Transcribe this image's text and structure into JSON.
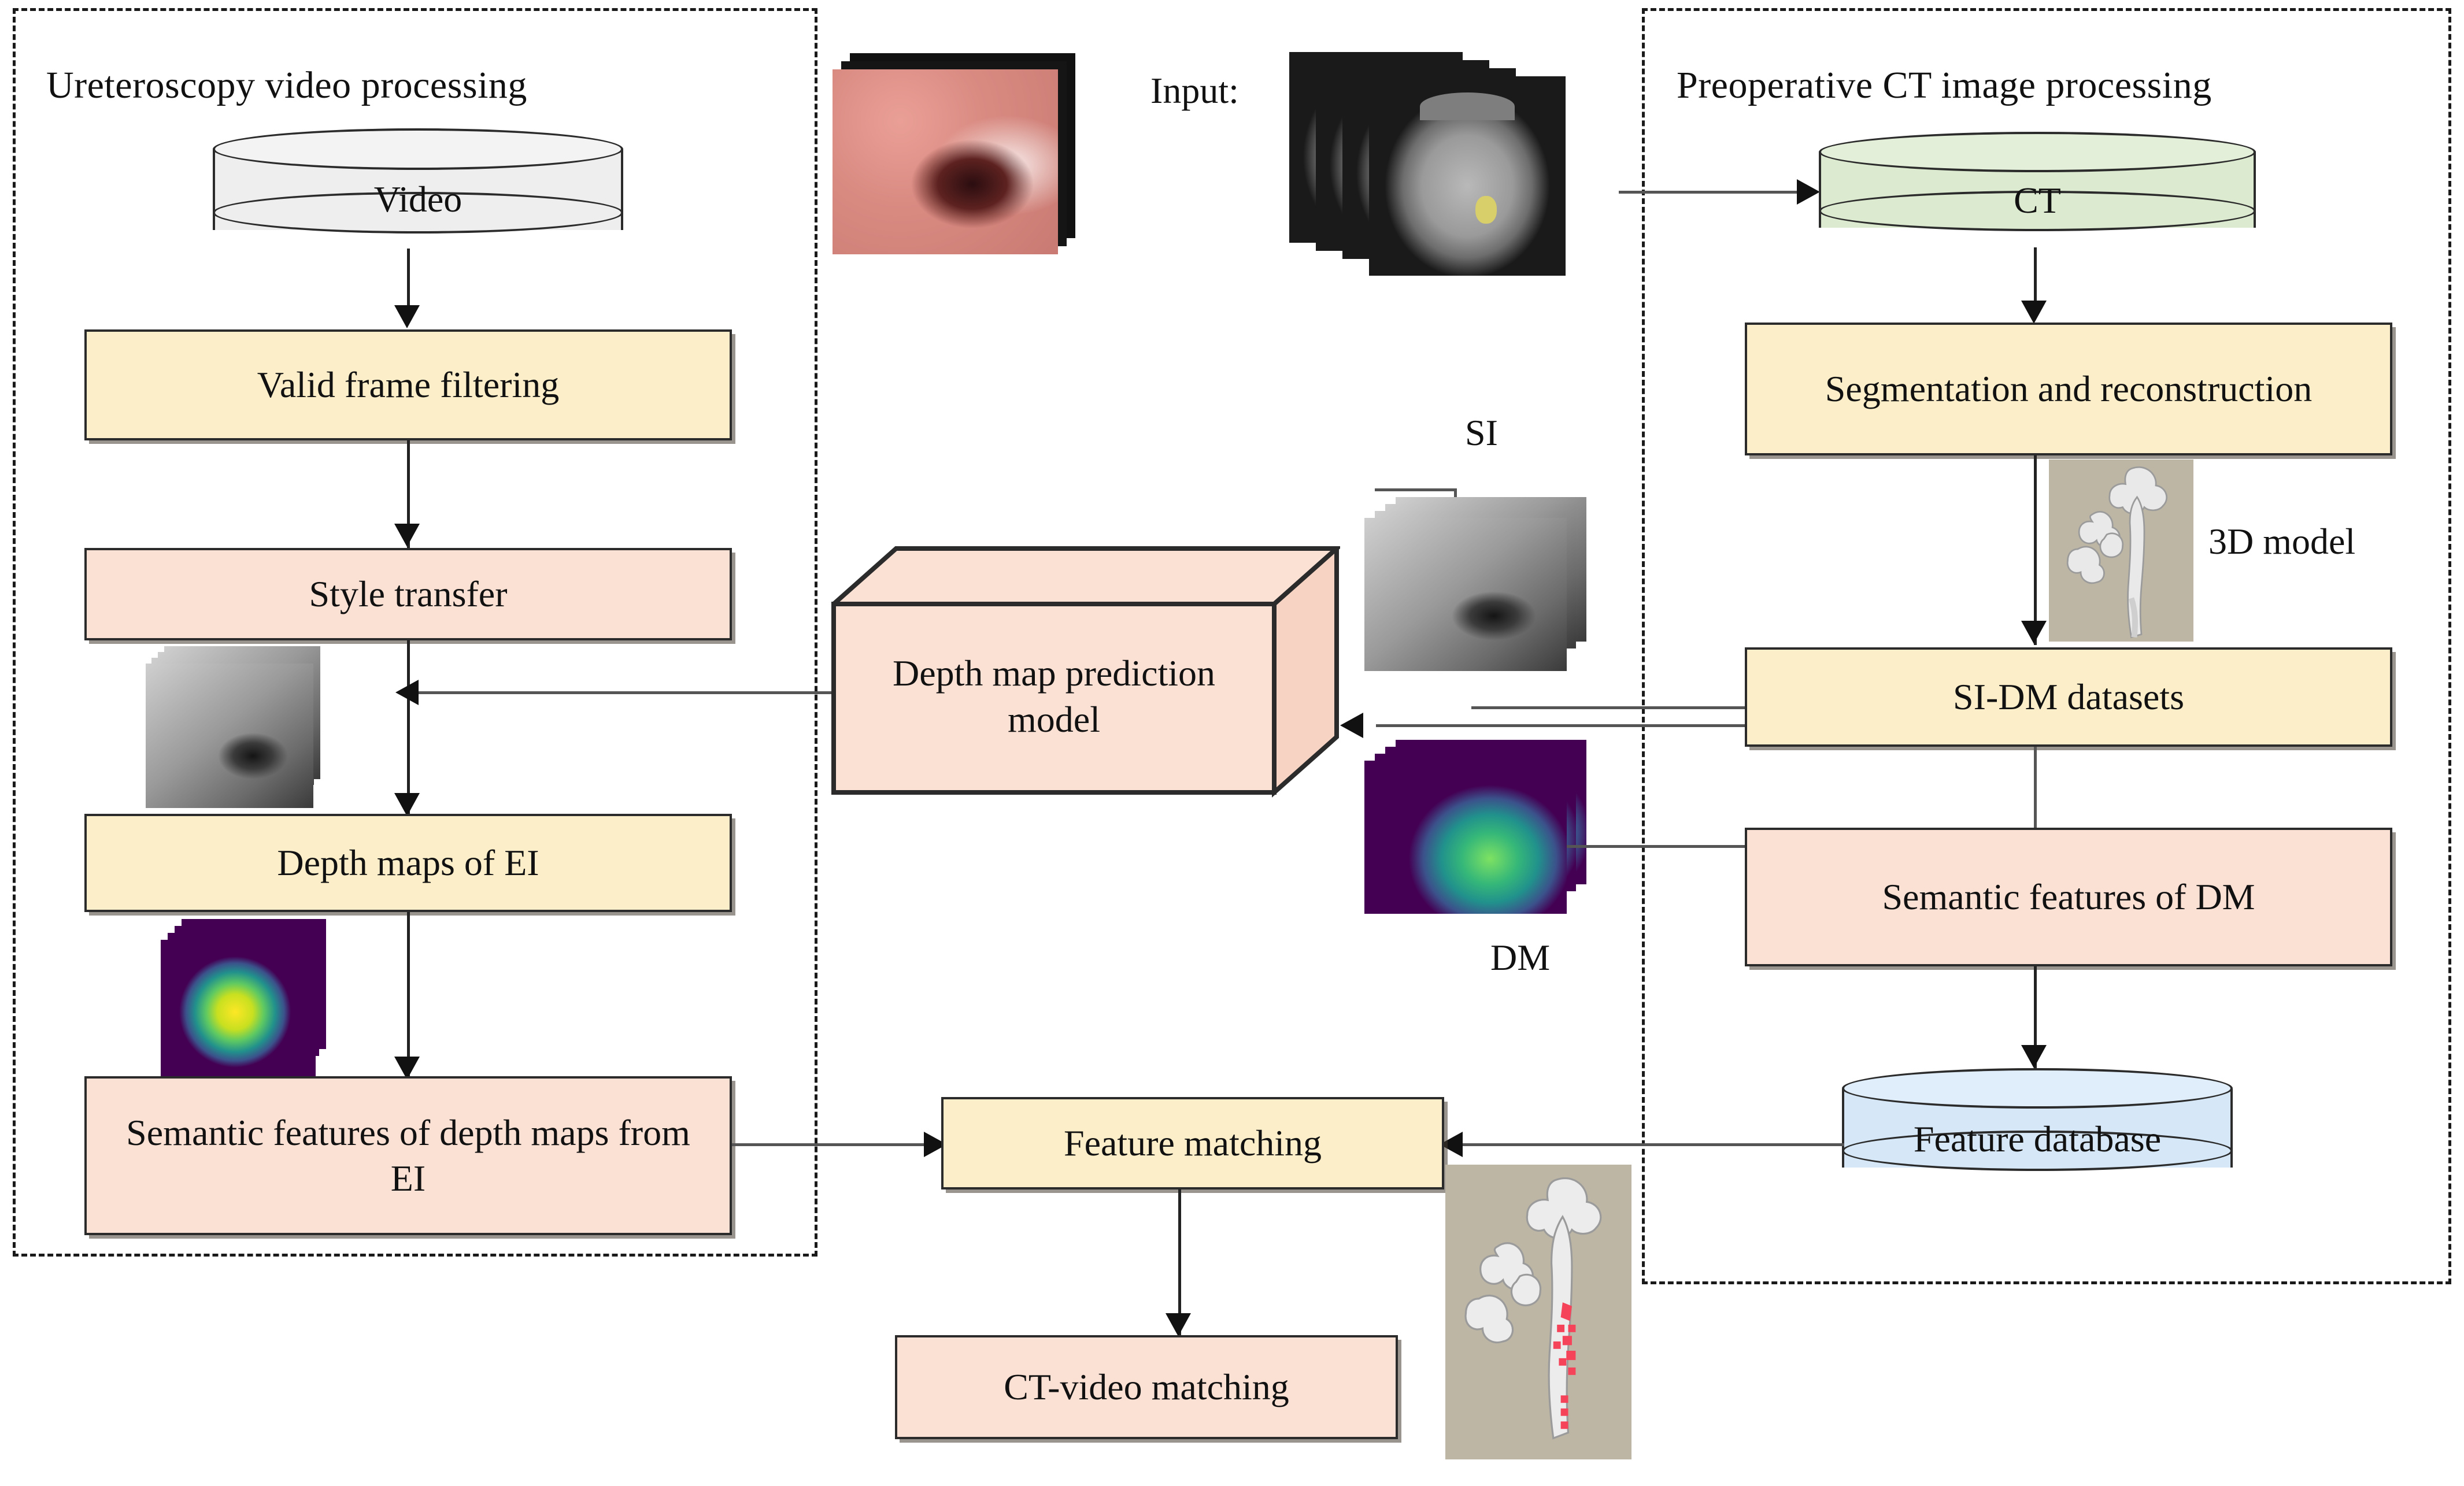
{
  "panels": {
    "left": {
      "title": "Ureteroscopy video processing"
    },
    "right": {
      "title": "Preoperative CT image processing"
    }
  },
  "labels": {
    "input": "Input:",
    "si": "SI",
    "dm": "DM",
    "model3d": "3D model"
  },
  "left_flow": {
    "video_store": "Video",
    "valid_frame_filtering": "Valid frame filtering",
    "style_transfer": "Style transfer",
    "depth_maps_of_ei": "Depth maps of EI",
    "semantic_features_ei": "Semantic features of depth maps from EI"
  },
  "center_flow": {
    "depth_model": "Depth map prediction model",
    "feature_matching": "Feature matching",
    "ct_video_matching": "CT-video matching"
  },
  "right_flow": {
    "ct_store": "CT",
    "segmentation": "Segmentation and reconstruction",
    "si_dm_datasets": "SI-DM datasets",
    "semantic_features_dm": "Semantic features of DM",
    "feature_database": "Feature database"
  },
  "colors": {
    "yellow_box": "#fbeec8",
    "pink_box": "#fbe0d4",
    "video_cylinder": "#eeeeee",
    "ct_cylinder": "#dcead0",
    "db_cylinder": "#d6e8f7",
    "border": "#2b2b2b",
    "connector": "#555555"
  }
}
